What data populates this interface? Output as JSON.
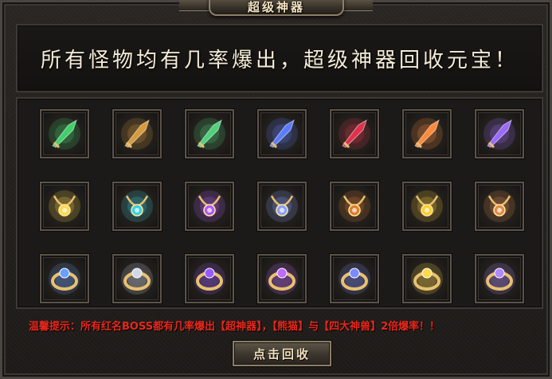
{
  "title": "超级神器",
  "banner_text": "所有怪物均有几率爆出，超级神器回收元宝！",
  "items": [
    {
      "name": "green-spear-icon",
      "color": "#3fd06a"
    },
    {
      "name": "golden-staff-icon",
      "color": "#d89a3a"
    },
    {
      "name": "jade-blade-icon",
      "color": "#4fd17a"
    },
    {
      "name": "blue-sword-icon",
      "color": "#5a7cff"
    },
    {
      "name": "red-sword-icon",
      "color": "#e0304a"
    },
    {
      "name": "fire-blade-icon",
      "color": "#ff8a3a"
    },
    {
      "name": "violet-axe-icon",
      "color": "#9a6aff"
    },
    {
      "name": "star-necklace-icon",
      "color": "#ffd84a"
    },
    {
      "name": "winged-necklace-icon",
      "color": "#3ad0e0"
    },
    {
      "name": "gem-necklace-icon",
      "color": "#b05aff"
    },
    {
      "name": "skull-necklace-icon",
      "color": "#8aa0ff"
    },
    {
      "name": "scorpion-necklace-icon",
      "color": "#e07a2a"
    },
    {
      "name": "gold-bracelet-icon",
      "color": "#ffcc33"
    },
    {
      "name": "bronze-bracelet-icon",
      "color": "#e08a4a"
    },
    {
      "name": "sapphire-ring-icon",
      "color": "#6aa0ff"
    },
    {
      "name": "silver-ring-icon",
      "color": "#d0d8e8"
    },
    {
      "name": "dark-ring-icon",
      "color": "#9a5aff"
    },
    {
      "name": "amethyst-ring-icon",
      "color": "#c06aff"
    },
    {
      "name": "orb-ring-icon",
      "color": "#7a8aff"
    },
    {
      "name": "golden-ring-icon",
      "color": "#ffd84a"
    },
    {
      "name": "crystal-ring-icon",
      "color": "#b08aff"
    }
  ],
  "hint_text": "温馨提示：所有红名BOSS都有几率爆出【超神器】，【熊猫】与【四大神兽】2倍爆率！！",
  "recycle_button_label": "点击回收"
}
